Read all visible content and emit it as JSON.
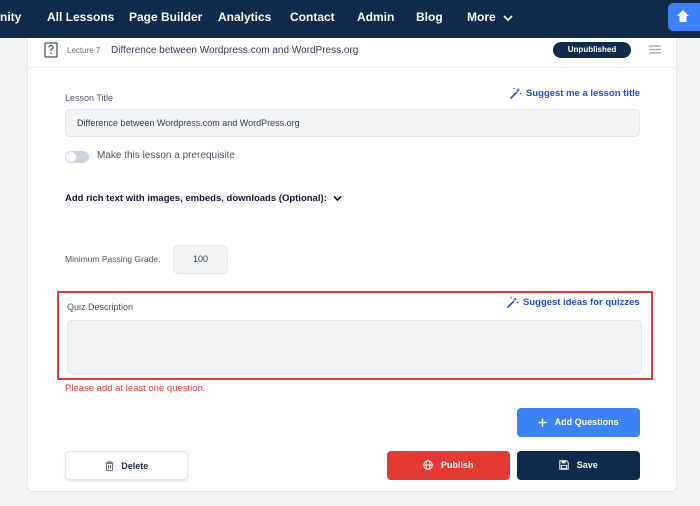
{
  "nav": {
    "items": [
      "nity",
      "All Lessons",
      "Page Builder",
      "Analytics",
      "Contact",
      "Admin",
      "Blog",
      "More"
    ]
  },
  "lecture": {
    "number": "Lecture 7",
    "title": "Difference between Wordpress.com and WordPress.org",
    "status": "Unpublished"
  },
  "form": {
    "lesson_title_label": "Lesson Title",
    "suggest_title_link": "Suggest me a lesson title",
    "lesson_title_value": "Difference between Wordpress.com and WordPress.org",
    "prerequisite_label": "Make this lesson a prerequisite",
    "prerequisite_on": false,
    "rich_text_label": "Add rich text with images, embeds, downloads (Optional):",
    "passing_grade_label": "Minimum Passing Grade:",
    "passing_grade_value": "100",
    "quiz_description_label": "Quiz Description",
    "suggest_quiz_link": "Suggest ideas for quizzes",
    "quiz_description_value": "",
    "error": "Please add at least one question."
  },
  "buttons": {
    "add_questions": "Add Questions",
    "delete": "Delete",
    "publish": "Publish",
    "save": "Save"
  },
  "colors": {
    "nav_bg": "#0f2a4a",
    "primary": "#3b82f6",
    "danger": "#e53935",
    "link": "#1d4ed8"
  },
  "icons": [
    "home-icon",
    "chevron-down-icon",
    "quiz-icon",
    "drag-handle-icon",
    "magic-wand-icon",
    "plus-icon",
    "trash-icon",
    "globe-icon",
    "save-icon"
  ]
}
